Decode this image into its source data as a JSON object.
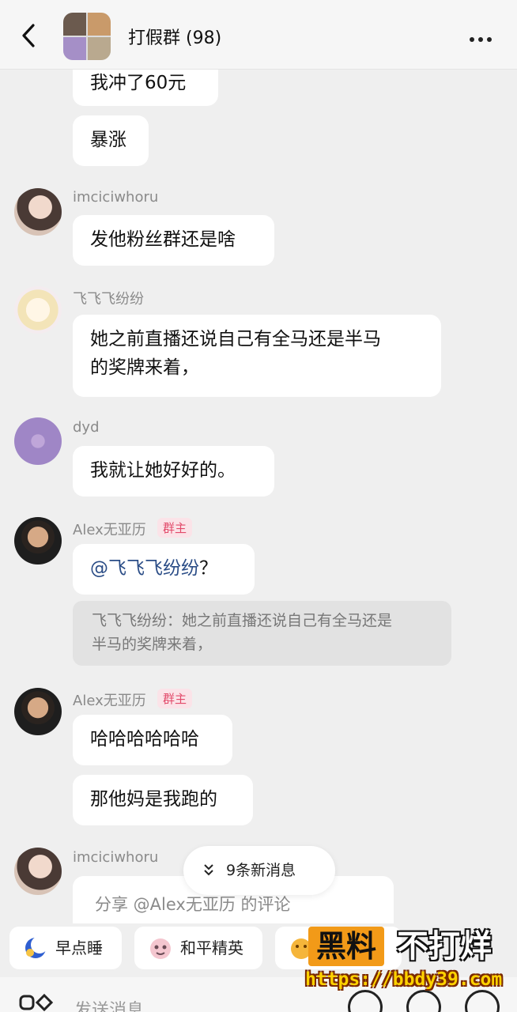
{
  "header": {
    "title": "打假群 (98)",
    "back_icon": "chevron-left-icon",
    "more_icon": "more-dots-icon"
  },
  "messages": {
    "m1": "我冲了60元",
    "m2": "暴涨",
    "u3": "imciciwhoru",
    "m3": "发他粉丝群还是啥",
    "u4": "飞飞飞纷纷",
    "m4_line1": "她之前直播还说自己有全马还是半马",
    "m4_line2": "的奖牌来着，",
    "u5": "dyd",
    "m5": "我就让她好好的。",
    "u6": "Alex无亚历",
    "badge6": "群主",
    "m6_mention": "@飞飞飞纷纷",
    "m6_suffix": "？",
    "quote6_line1": "飞飞飞纷纷：她之前直播还说自己有全马还是",
    "quote6_line2": "半马的奖牌来着，",
    "u7": "Alex无亚历",
    "badge7": "群主",
    "m7a": "哈哈哈哈哈哈",
    "m7b": "那他妈是我跑的",
    "u8": "imciciwhoru",
    "m8": "分享 @Alex无亚历 的评论"
  },
  "new_messages": {
    "label": "9条新消息",
    "icon": "double-chevron-down-icon"
  },
  "quick_replies": [
    {
      "label": "早点睡",
      "icon": "moon-icon"
    },
    {
      "label": "和平精英",
      "icon": "sticker-icon"
    },
    {
      "label": "",
      "icon": "emoji-icon"
    }
  ],
  "watermark": {
    "part1": "黑料",
    "part2": "不打烊",
    "url": "https://bbdy39.com"
  },
  "input": {
    "placeholder": "发送消息"
  }
}
